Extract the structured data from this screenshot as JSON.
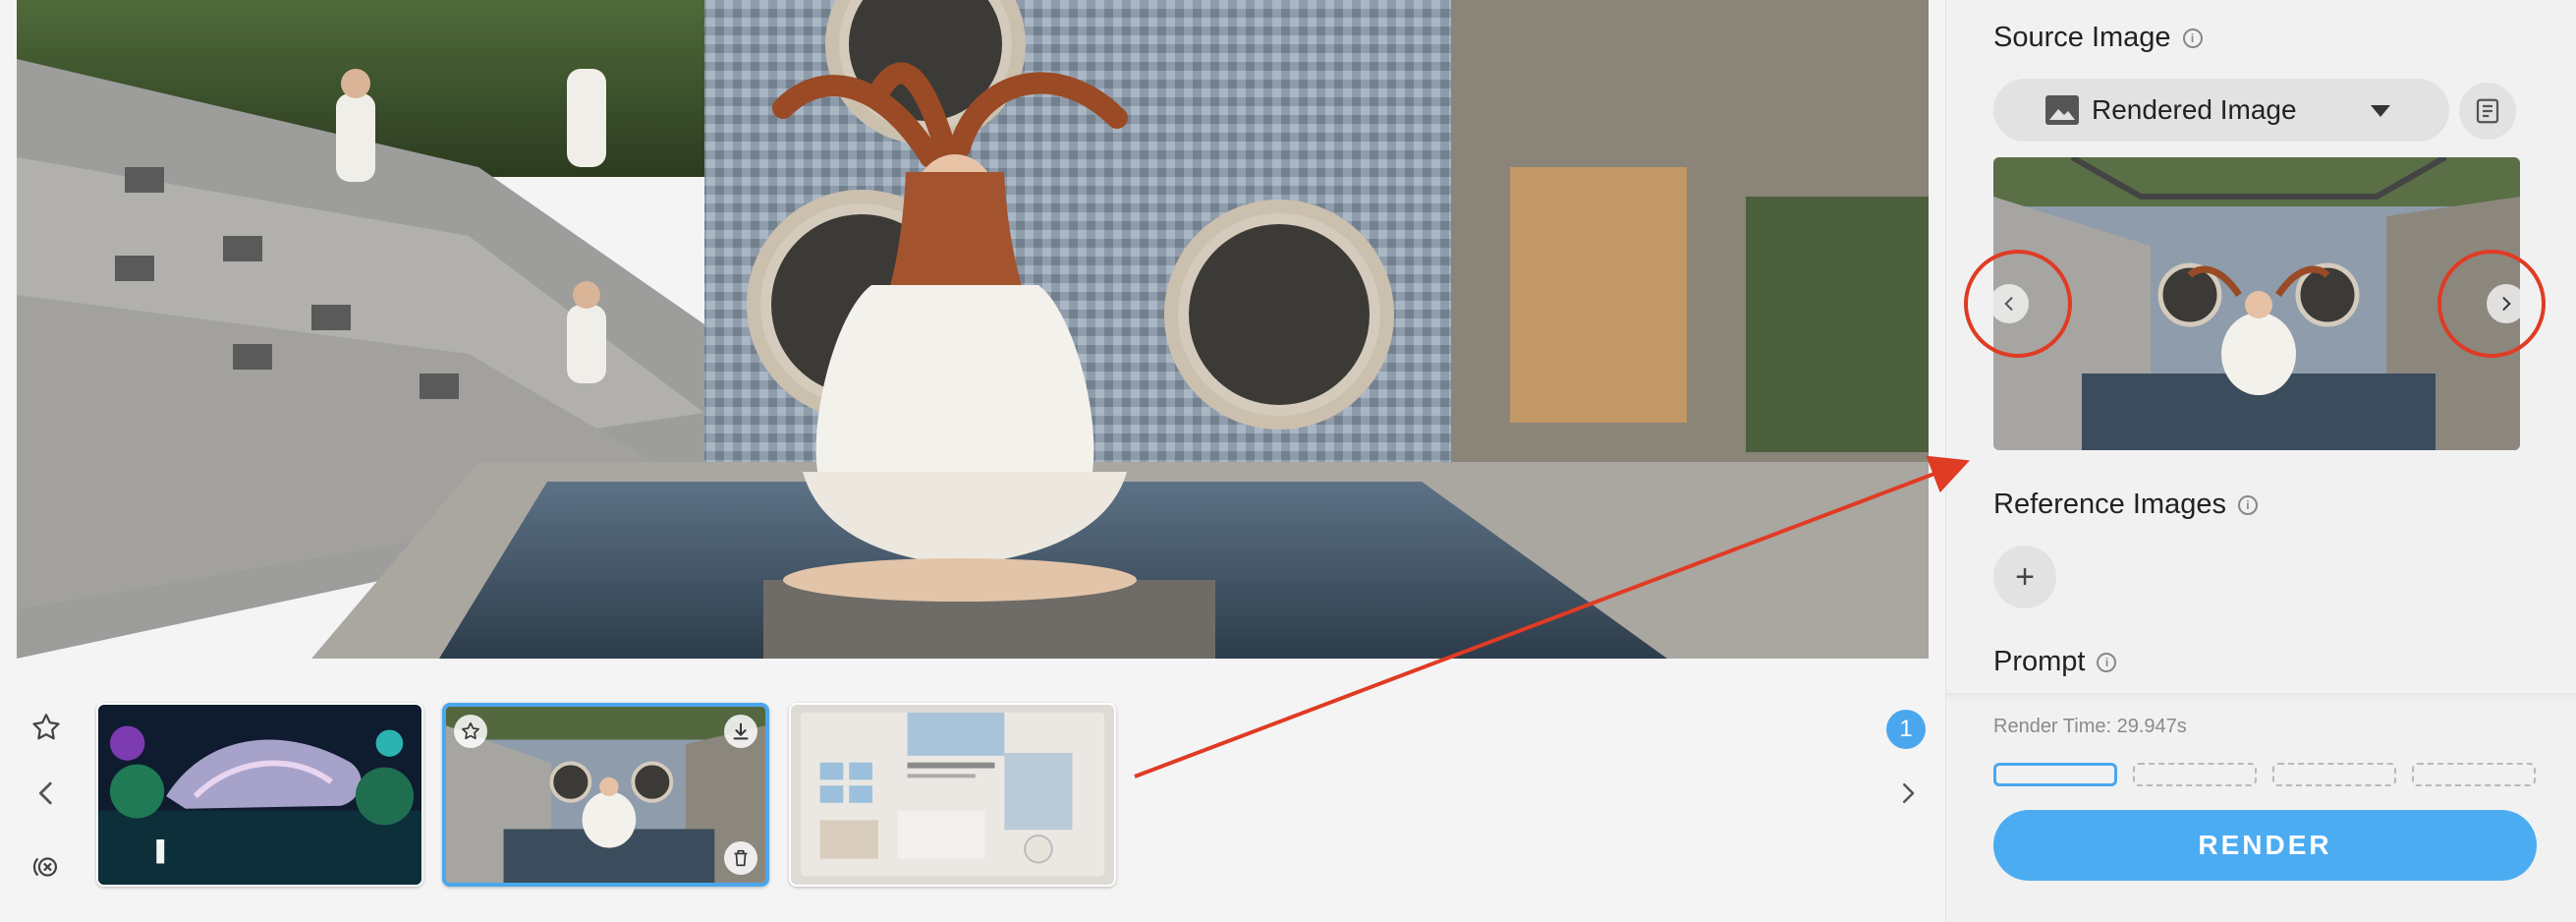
{
  "panel": {
    "source_image_title": "Source Image",
    "source_select_value": "Rendered Image",
    "reference_images_title": "Reference Images",
    "add_symbol": "+",
    "prompt_title": "Prompt",
    "render_time": "Render Time: 29.947s",
    "render_button": "RENDER"
  },
  "strip": {
    "page_badge": "1"
  },
  "icons": {
    "tools": [
      "star-icon",
      "chevron-left-icon",
      "clear-icon"
    ],
    "thumb_actions": [
      "star-icon",
      "download-icon",
      "trash-icon"
    ],
    "panel": [
      "image-icon",
      "document-icon",
      "info-icon"
    ]
  },
  "colors": {
    "accent": "#4aa7ee",
    "render_button": "#4cacf2",
    "annotation": "#e03b24"
  }
}
